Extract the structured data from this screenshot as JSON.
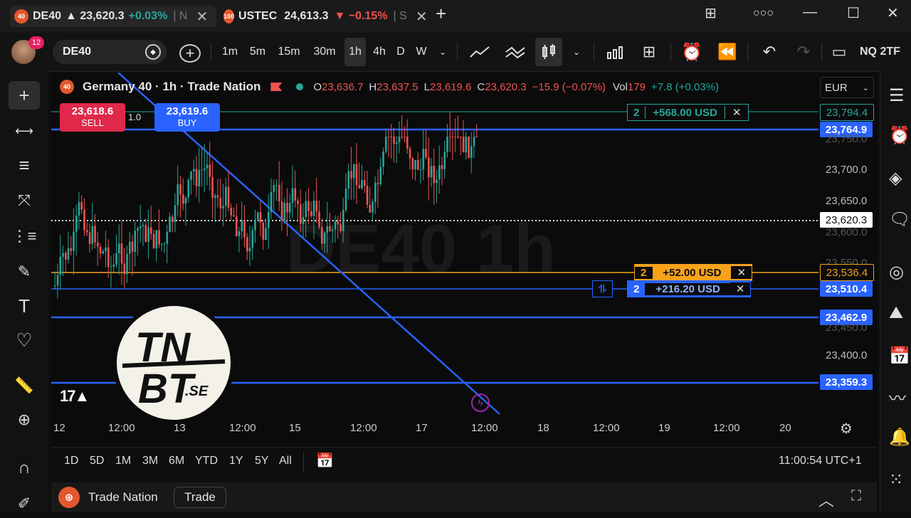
{
  "tabs": [
    {
      "badge": "40",
      "symbol": "DE40",
      "price": "▲ 23,620.3",
      "change": "+0.03%",
      "suffix": "| N"
    },
    {
      "badge": "100",
      "symbol": "USTEC",
      "price": "24,613.3",
      "change": "▼ −0.15%",
      "suffix": "| S"
    }
  ],
  "header": {
    "symbol": "DE40",
    "avatar_badge": "12",
    "right_symbol": "NQ 2TF"
  },
  "intervals": [
    "1m",
    "5m",
    "15m",
    "30m",
    "1h",
    "4h",
    "D",
    "W"
  ],
  "selected_interval": "1h",
  "legend": {
    "badge": "40",
    "title": "Germany 40 · 1h · Trade Nation",
    "o": "23,636.7",
    "h": "23,637.5",
    "l": "23,619.6",
    "c": "23,620.3",
    "chg": "−15.9 (−0.07%)",
    "vol_label": "Vol",
    "vol": "179",
    "vol_chg": "+7.8 (+0.03%)"
  },
  "currency": "EUR",
  "trade": {
    "sell_price": "23,618.6",
    "sell_label": "SELL",
    "qty": "1.0",
    "buy_price": "23,619.6",
    "buy_label": "BUY"
  },
  "orders": [
    {
      "qty": "2",
      "pnl": "+568.00 USD",
      "color": "#26a69a"
    },
    {
      "qty": "2",
      "pnl": "+52.00 USD",
      "color": "#f7a21b"
    },
    {
      "qty": "2",
      "pnl": "+216.20 USD",
      "color": "#2962ff"
    }
  ],
  "price_labels": [
    "23,794.4",
    "23,764.9",
    "23,750.0",
    "23,700.0",
    "23,650.0",
    "23,620.3",
    "23,600.0",
    "23,550.0",
    "23,536.4",
    "23,510.4",
    "23,462.9",
    "23,450.0",
    "23,400.0",
    "23,359.3"
  ],
  "x_labels": [
    "12",
    "12:00",
    "13",
    "12:00",
    "15",
    "12:00",
    "17",
    "12:00",
    "18",
    "12:00",
    "19",
    "12:00",
    "20"
  ],
  "watermark": "DE40  1h",
  "logo_text": {
    "line1": "TN",
    "line2": "BT",
    "suffix": ".SE"
  },
  "ranges": [
    "1D",
    "5D",
    "1M",
    "3M",
    "6M",
    "YTD",
    "1Y",
    "5Y",
    "All"
  ],
  "clock": "11:00:54 UTC+1",
  "footer": {
    "brand": "Trade Nation",
    "button": "Trade"
  },
  "colors": {
    "up": "#26a69a",
    "down": "#ef5350",
    "blue": "#2962ff",
    "orange": "#f7a21b"
  }
}
